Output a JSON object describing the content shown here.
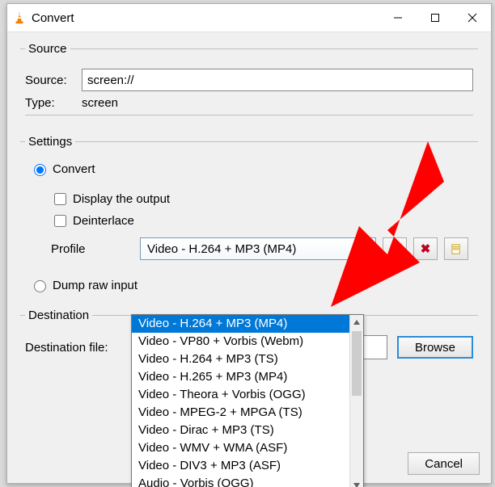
{
  "window": {
    "title": "Convert"
  },
  "source": {
    "legend": "Source",
    "source_label": "Source:",
    "source_value": "screen://",
    "type_label": "Type:",
    "type_value": "screen"
  },
  "settings": {
    "legend": "Settings",
    "convert_label": "Convert",
    "display_output_label": "Display the output",
    "deinterlace_label": "Deinterlace",
    "profile_label": "Profile",
    "profile_selected": "Video - H.264 + MP3 (MP4)",
    "profile_options": [
      "Video - H.264 + MP3 (MP4)",
      "Video - VP80 + Vorbis (Webm)",
      "Video - H.264 + MP3 (TS)",
      "Video - H.265 + MP3 (MP4)",
      "Video - Theora + Vorbis (OGG)",
      "Video - MPEG-2 + MPGA (TS)",
      "Video - Dirac + MP3 (TS)",
      "Video - WMV + WMA (ASF)",
      "Video - DIV3 + MP3 (ASF)",
      "Audio - Vorbis (OGG)"
    ],
    "dump_raw_label": "Dump raw input"
  },
  "destination": {
    "legend": "Destination",
    "file_label": "Destination file:",
    "browse_label": "Browse"
  },
  "buttons": {
    "cancel": "Cancel"
  },
  "colors": {
    "accent": "#2a8dd4",
    "selection": "#0078d7",
    "arrow": "#ff0000"
  }
}
